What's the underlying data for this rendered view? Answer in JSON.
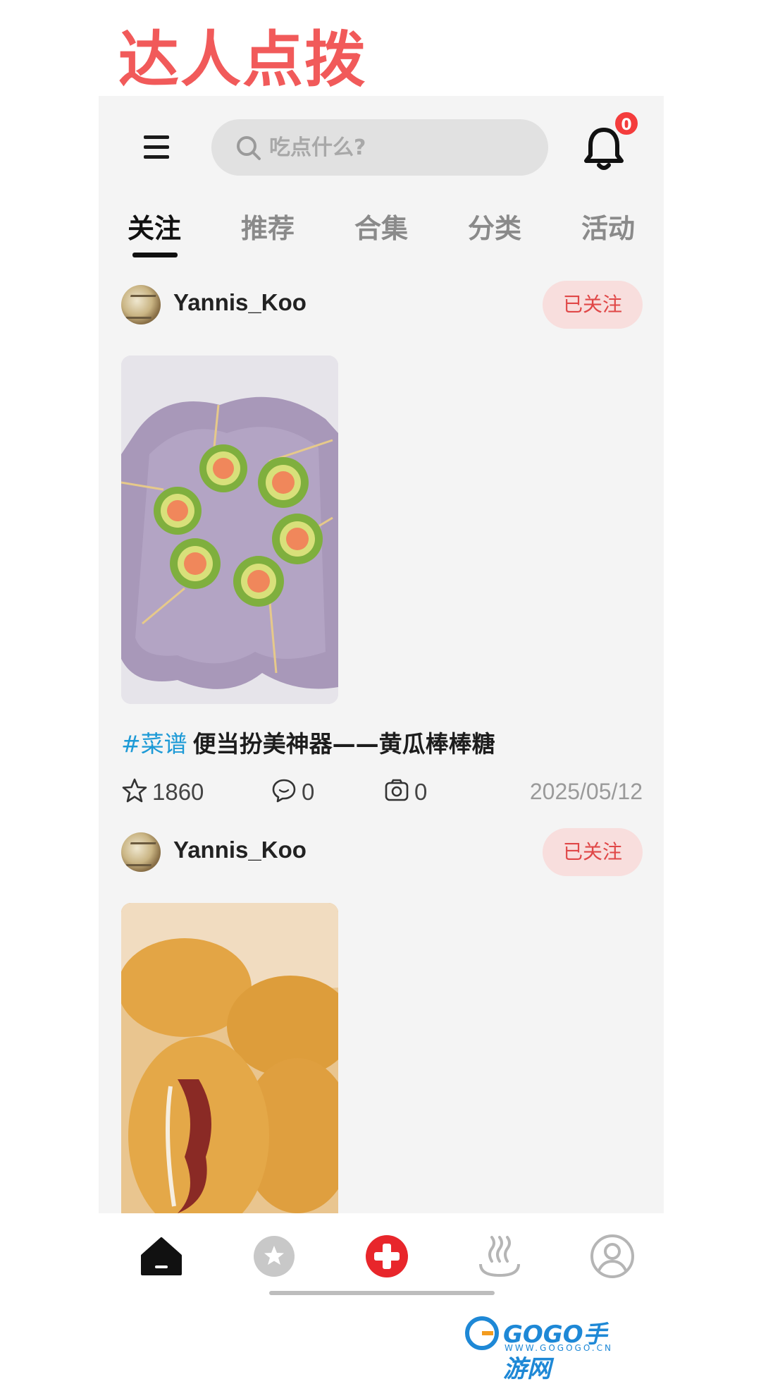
{
  "page_title": "达人点拨",
  "header": {
    "search_placeholder": "吃点什么?",
    "notification_count": "0"
  },
  "tabs": [
    {
      "label": "关注",
      "active": true
    },
    {
      "label": "推荐",
      "active": false
    },
    {
      "label": "合集",
      "active": false
    },
    {
      "label": "分类",
      "active": false
    },
    {
      "label": "活动",
      "active": false
    }
  ],
  "posts": [
    {
      "author": "Yannis_Koo",
      "follow_label": "已关注",
      "tag": "#菜谱",
      "title": "便当扮美神器——黄瓜棒棒糖",
      "likes": "1860",
      "comments": "0",
      "photos": "0",
      "date": "2025/05/12"
    },
    {
      "author": "Yannis_Koo",
      "follow_label": "已关注"
    }
  ],
  "bottom_nav": [
    "home-icon",
    "favorites-icon",
    "add-icon",
    "steam-icon",
    "profile-icon"
  ],
  "watermark": {
    "text": "GOGO手游网",
    "sub": "WWW.GOGOGO.CN"
  },
  "colors": {
    "accent": "#f43c3c",
    "title": "#f15a5a",
    "tag": "#1d9ad6",
    "follow_bg": "#f8dedd"
  }
}
